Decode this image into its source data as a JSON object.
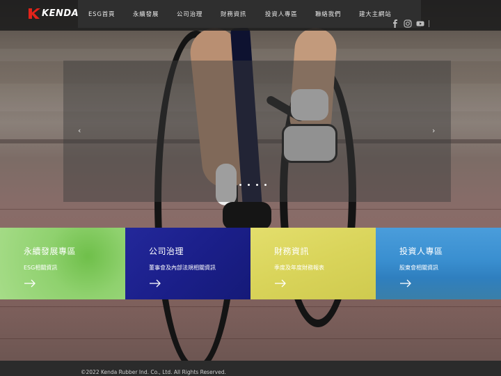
{
  "brand": {
    "logo_text": "KENDA",
    "accent_color": "#e2231a"
  },
  "nav": {
    "items": [
      {
        "label": "ESG首頁"
      },
      {
        "label": "永續發展"
      },
      {
        "label": "公司治理"
      },
      {
        "label": "財務資訊"
      },
      {
        "label": "投資人專區"
      },
      {
        "label": "聯絡我們"
      },
      {
        "label": "建大主網站"
      }
    ]
  },
  "social": {
    "icons": [
      "facebook-icon",
      "instagram-icon",
      "youtube-icon"
    ]
  },
  "slider": {
    "prev_glyph": "‹",
    "next_glyph": "›",
    "slide_count": 4
  },
  "tiles": [
    {
      "title": "永續發展專區",
      "subtitle": "ESG相關資訊",
      "color": "#8fd16e"
    },
    {
      "title": "公司治理",
      "subtitle": "董事會及內部法規相關資訊",
      "color": "#1b1f8a"
    },
    {
      "title": "財務資訊",
      "subtitle": "季度及年度財務報表",
      "color": "#d9d45a"
    },
    {
      "title": "投資人專區",
      "subtitle": "股東會相關資訊",
      "color": "#3a8fd0"
    }
  ],
  "footer": {
    "copyright": "©2022 Kenda Rubber Ind. Co., Ltd. All Rights Reserved."
  }
}
